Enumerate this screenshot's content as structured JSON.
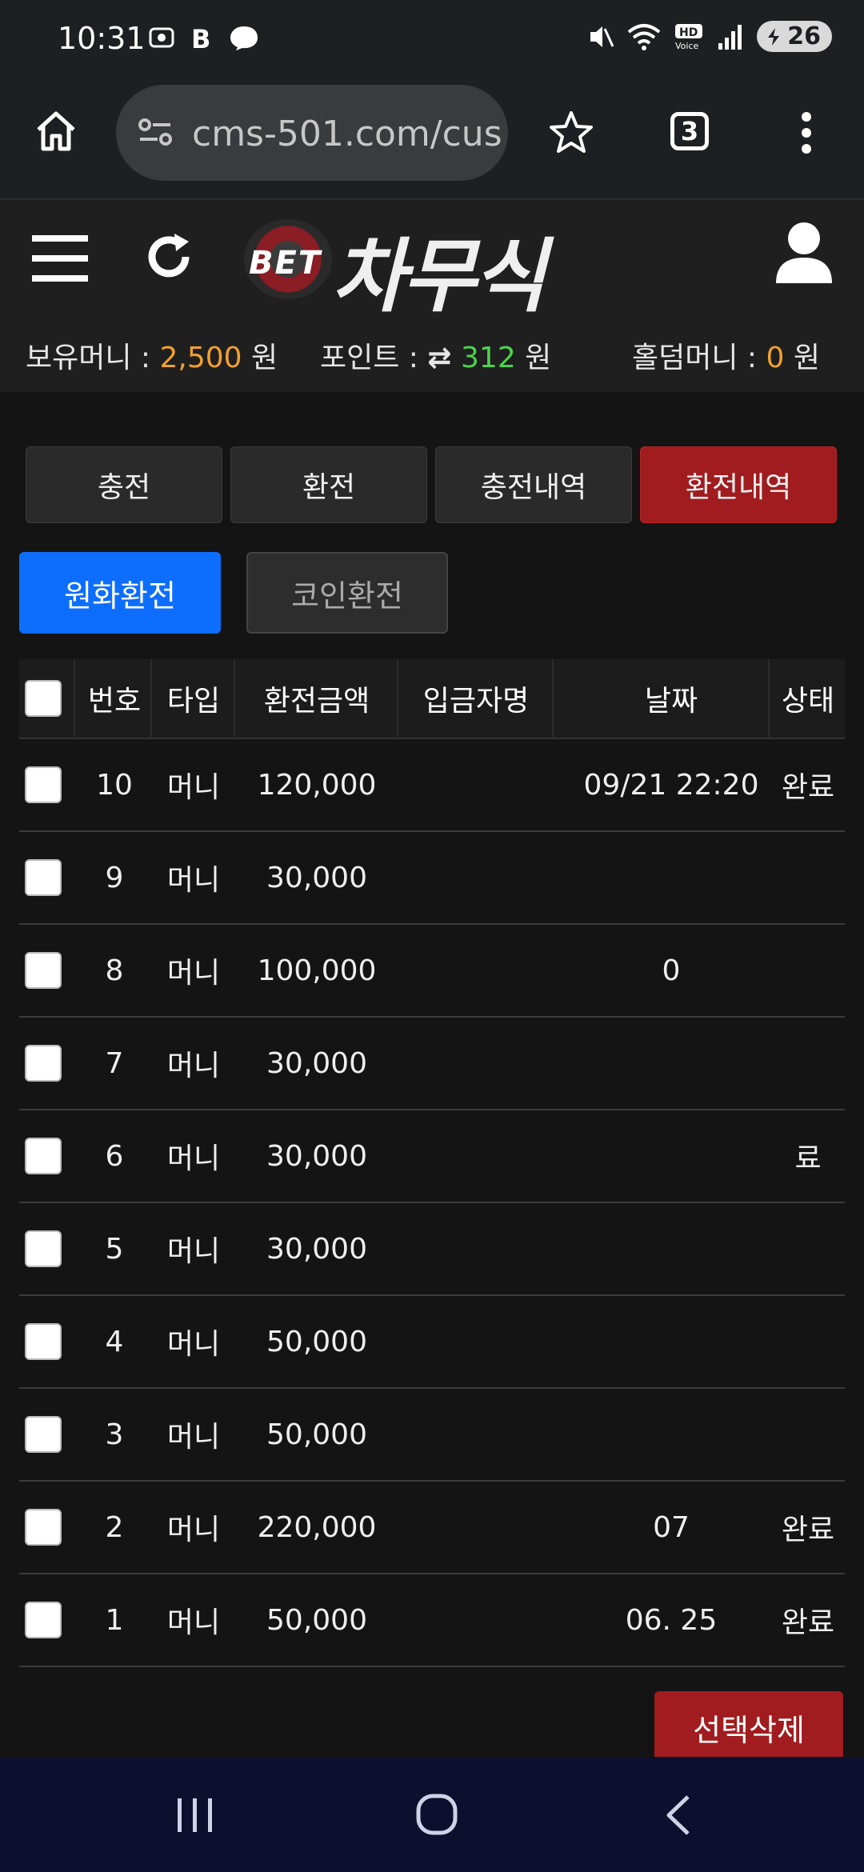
{
  "status_bar": {
    "time": "10:31",
    "battery": "26",
    "icons": [
      "screenshot-icon",
      "b-app-icon",
      "messenger-icon",
      "mute-icon",
      "wifi-icon",
      "hd-voice-icon",
      "signal-icon",
      "battery-icon"
    ]
  },
  "browser": {
    "url": "cms-501.com/cus",
    "tab_count": "3"
  },
  "site": {
    "logo_bet": "BET",
    "logo_title": "차무식",
    "balance": {
      "money_label": "보유머니 : ",
      "money_value": "2,500",
      "money_unit": " 원",
      "point_label": "포인트 : ",
      "point_value": "312",
      "point_unit": " 원",
      "hold_label": "홀덤머니 : ",
      "hold_value": "0",
      "hold_unit": " 원"
    }
  },
  "tabs": [
    {
      "label": "충전",
      "active": false
    },
    {
      "label": "환전",
      "active": false
    },
    {
      "label": "충전내역",
      "active": false
    },
    {
      "label": "환전내역",
      "active": true
    }
  ],
  "subtabs": [
    {
      "label": "원화환전",
      "active": true
    },
    {
      "label": "코인환전",
      "active": false
    }
  ],
  "table": {
    "headers": [
      "번호",
      "타입",
      "환전금액",
      "입금자명",
      "날짜",
      "상태"
    ],
    "rows": [
      {
        "num": "10",
        "type": "머니",
        "amount": "120,000",
        "name": "",
        "date": "09/21 22:20",
        "status": "완료"
      },
      {
        "num": "9",
        "type": "머니",
        "amount": "30,000",
        "name": "",
        "date": "",
        "status": ""
      },
      {
        "num": "8",
        "type": "머니",
        "amount": "100,000",
        "name": "",
        "date": "0",
        "status": ""
      },
      {
        "num": "7",
        "type": "머니",
        "amount": "30,000",
        "name": "",
        "date": "",
        "status": ""
      },
      {
        "num": "6",
        "type": "머니",
        "amount": "30,000",
        "name": "",
        "date": "",
        "status": "료"
      },
      {
        "num": "5",
        "type": "머니",
        "amount": "30,000",
        "name": "",
        "date": "",
        "status": ""
      },
      {
        "num": "4",
        "type": "머니",
        "amount": "50,000",
        "name": "",
        "date": "",
        "status": ""
      },
      {
        "num": "3",
        "type": "머니",
        "amount": "50,000",
        "name": "",
        "date": "",
        "status": ""
      },
      {
        "num": "2",
        "type": "머니",
        "amount": "220,000",
        "name": "",
        "date": "07",
        "status": "완료"
      },
      {
        "num": "1",
        "type": "머니",
        "amount": "50,000",
        "name": "",
        "date": "06. 25",
        "status": "완료"
      }
    ]
  },
  "delete_button": "선택삭제",
  "colors": {
    "accent_red": "#a11c1f",
    "accent_blue": "#0d6efd",
    "money_orange": "#f0a030",
    "point_green": "#4cd44c"
  }
}
